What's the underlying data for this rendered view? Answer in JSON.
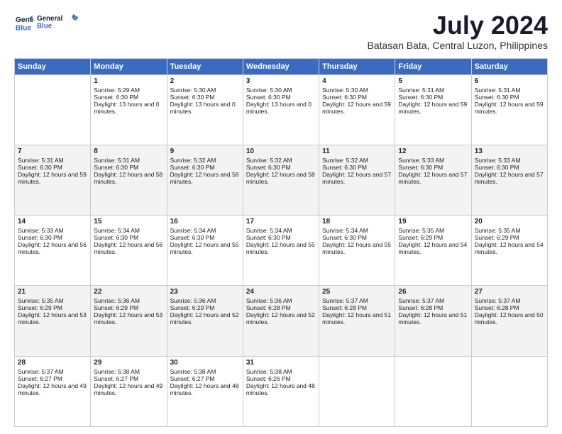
{
  "logo": {
    "line1": "General",
    "line2": "Blue"
  },
  "title": "July 2024",
  "location": "Batasan Bata, Central Luzon, Philippines",
  "headers": [
    "Sunday",
    "Monday",
    "Tuesday",
    "Wednesday",
    "Thursday",
    "Friday",
    "Saturday"
  ],
  "weeks": [
    [
      {
        "day": "",
        "empty": true
      },
      {
        "day": "1",
        "sunrise": "5:29 AM",
        "sunset": "6:30 PM",
        "daylight": "13 hours and 0 minutes."
      },
      {
        "day": "2",
        "sunrise": "5:30 AM",
        "sunset": "6:30 PM",
        "daylight": "13 hours and 0 minutes."
      },
      {
        "day": "3",
        "sunrise": "5:30 AM",
        "sunset": "6:30 PM",
        "daylight": "13 hours and 0 minutes."
      },
      {
        "day": "4",
        "sunrise": "5:30 AM",
        "sunset": "6:30 PM",
        "daylight": "12 hours and 59 minutes."
      },
      {
        "day": "5",
        "sunrise": "5:31 AM",
        "sunset": "6:30 PM",
        "daylight": "12 hours and 59 minutes."
      },
      {
        "day": "6",
        "sunrise": "5:31 AM",
        "sunset": "6:30 PM",
        "daylight": "12 hours and 59 minutes."
      }
    ],
    [
      {
        "day": "7",
        "sunrise": "5:31 AM",
        "sunset": "6:30 PM",
        "daylight": "12 hours and 59 minutes."
      },
      {
        "day": "8",
        "sunrise": "5:31 AM",
        "sunset": "6:30 PM",
        "daylight": "12 hours and 58 minutes."
      },
      {
        "day": "9",
        "sunrise": "5:32 AM",
        "sunset": "6:30 PM",
        "daylight": "12 hours and 58 minutes."
      },
      {
        "day": "10",
        "sunrise": "5:32 AM",
        "sunset": "6:30 PM",
        "daylight": "12 hours and 58 minutes."
      },
      {
        "day": "11",
        "sunrise": "5:32 AM",
        "sunset": "6:30 PM",
        "daylight": "12 hours and 57 minutes."
      },
      {
        "day": "12",
        "sunrise": "5:33 AM",
        "sunset": "6:30 PM",
        "daylight": "12 hours and 57 minutes."
      },
      {
        "day": "13",
        "sunrise": "5:33 AM",
        "sunset": "6:30 PM",
        "daylight": "12 hours and 57 minutes."
      }
    ],
    [
      {
        "day": "14",
        "sunrise": "5:33 AM",
        "sunset": "6:30 PM",
        "daylight": "12 hours and 56 minutes."
      },
      {
        "day": "15",
        "sunrise": "5:34 AM",
        "sunset": "6:30 PM",
        "daylight": "12 hours and 56 minutes."
      },
      {
        "day": "16",
        "sunrise": "5:34 AM",
        "sunset": "6:30 PM",
        "daylight": "12 hours and 55 minutes."
      },
      {
        "day": "17",
        "sunrise": "5:34 AM",
        "sunset": "6:30 PM",
        "daylight": "12 hours and 55 minutes."
      },
      {
        "day": "18",
        "sunrise": "5:34 AM",
        "sunset": "6:30 PM",
        "daylight": "12 hours and 55 minutes."
      },
      {
        "day": "19",
        "sunrise": "5:35 AM",
        "sunset": "6:29 PM",
        "daylight": "12 hours and 54 minutes."
      },
      {
        "day": "20",
        "sunrise": "5:35 AM",
        "sunset": "6:29 PM",
        "daylight": "12 hours and 54 minutes."
      }
    ],
    [
      {
        "day": "21",
        "sunrise": "5:35 AM",
        "sunset": "6:29 PM",
        "daylight": "12 hours and 53 minutes."
      },
      {
        "day": "22",
        "sunrise": "5:36 AM",
        "sunset": "6:29 PM",
        "daylight": "12 hours and 53 minutes."
      },
      {
        "day": "23",
        "sunrise": "5:36 AM",
        "sunset": "6:29 PM",
        "daylight": "12 hours and 52 minutes."
      },
      {
        "day": "24",
        "sunrise": "5:36 AM",
        "sunset": "6:28 PM",
        "daylight": "12 hours and 52 minutes."
      },
      {
        "day": "25",
        "sunrise": "5:37 AM",
        "sunset": "6:28 PM",
        "daylight": "12 hours and 51 minutes."
      },
      {
        "day": "26",
        "sunrise": "5:37 AM",
        "sunset": "6:28 PM",
        "daylight": "12 hours and 51 minutes."
      },
      {
        "day": "27",
        "sunrise": "5:37 AM",
        "sunset": "6:28 PM",
        "daylight": "12 hours and 50 minutes."
      }
    ],
    [
      {
        "day": "28",
        "sunrise": "5:37 AM",
        "sunset": "6:27 PM",
        "daylight": "12 hours and 49 minutes."
      },
      {
        "day": "29",
        "sunrise": "5:38 AM",
        "sunset": "6:27 PM",
        "daylight": "12 hours and 49 minutes."
      },
      {
        "day": "30",
        "sunrise": "5:38 AM",
        "sunset": "6:27 PM",
        "daylight": "12 hours and 48 minutes."
      },
      {
        "day": "31",
        "sunrise": "5:38 AM",
        "sunset": "6:26 PM",
        "daylight": "12 hours and 48 minutes."
      },
      {
        "day": "",
        "empty": true
      },
      {
        "day": "",
        "empty": true
      },
      {
        "day": "",
        "empty": true
      }
    ]
  ]
}
